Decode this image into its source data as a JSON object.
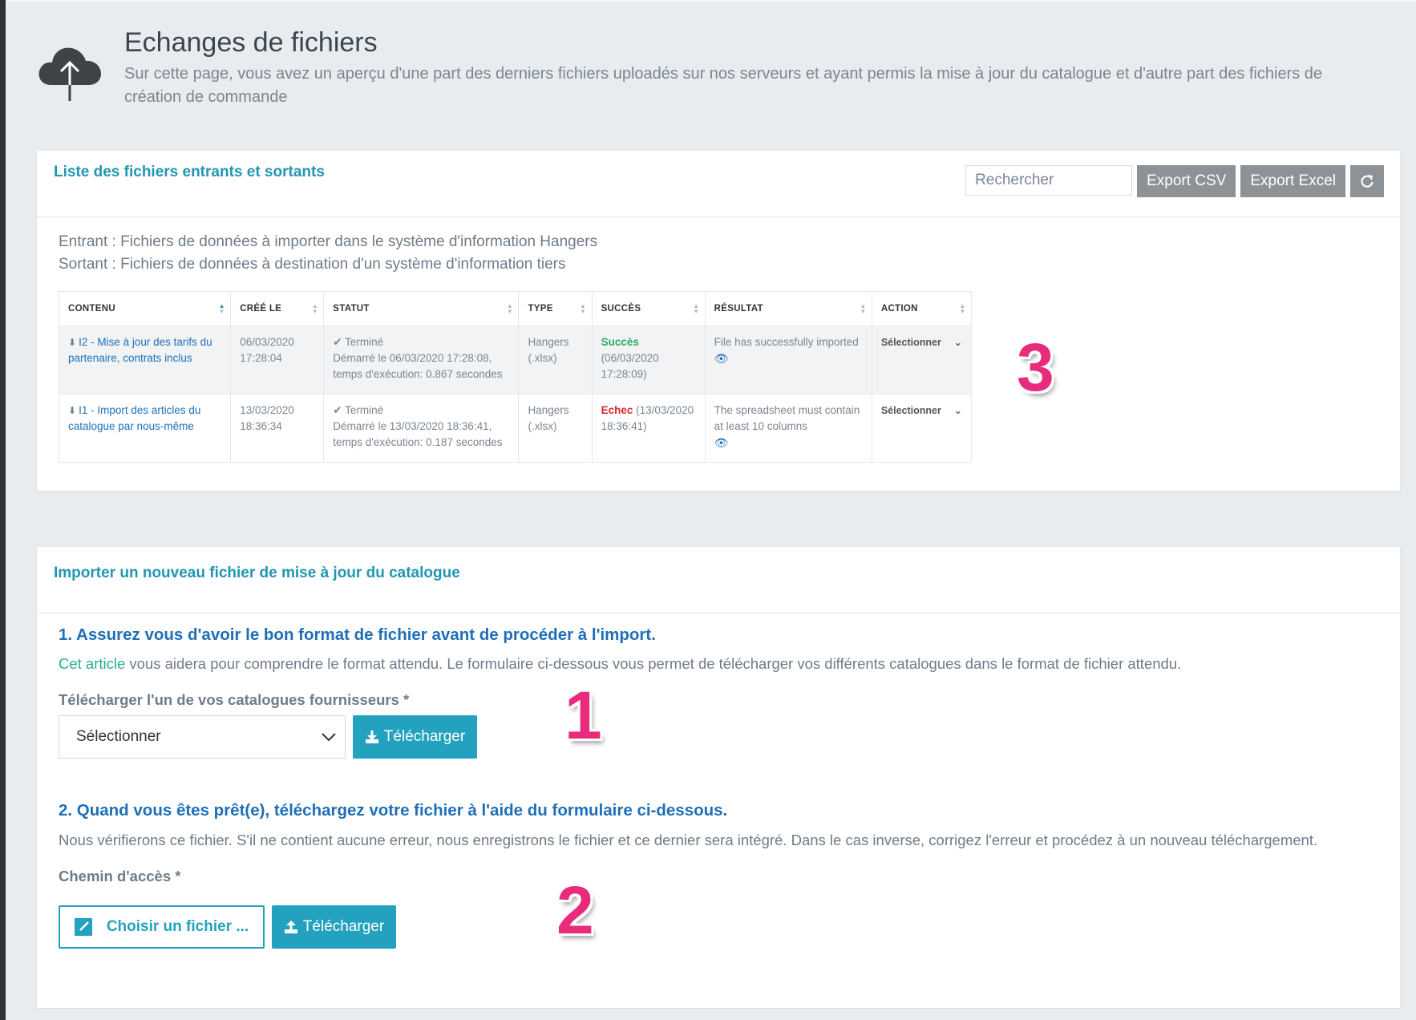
{
  "header": {
    "title": "Echanges de fichiers",
    "description": "Sur cette page, vous avez un aperçu d'une part des derniers fichiers uploadés sur nos serveurs et ayant permis la mise à jour du catalogue et d'autre part des fichiers de création de commande",
    "icon": "cloud-upload-icon"
  },
  "files_card": {
    "title": "Liste des fichiers entrants et sortants",
    "search_placeholder": "Rechercher",
    "export_csv": "Export CSV",
    "export_excel": "Export Excel",
    "refresh_icon": "refresh-icon",
    "legend_in": "Entrant : Fichiers de données à importer dans le système d'information Hangers",
    "legend_out": "Sortant : Fichiers de données à destination d'un système d'information tiers",
    "columns": [
      "CONTENU",
      "CRÉÉ LE",
      "STATUT",
      "TYPE",
      "SUCCÈS",
      "RÉSULTAT",
      "ACTION"
    ],
    "rows": [
      {
        "contenu": "I2 - Mise à jour des tarifs du partenaire, contrats inclus",
        "cree_le": "06/03/2020 17:28:04",
        "statut": "Terminé",
        "statut_detail": "Démarré le 06/03/2020 17:28:08, temps d'exécution: 0.867 secondes",
        "type": "Hangers (.xlsx)",
        "succes_label": "Succès",
        "succes_detail": "(06/03/2020 17:28:09)",
        "resultat": "File has successfully imported",
        "action": "Sélectionner"
      },
      {
        "contenu": "I1 - Import des articles du catalogue par nous-même",
        "cree_le": "13/03/2020 18:36:34",
        "statut": "Terminé",
        "statut_detail": "Démarré le 13/03/2020 18:36:41, temps d'exécution: 0.187 secondes",
        "type": "Hangers (.xlsx)",
        "succes_label": "Echec",
        "succes_detail": "(13/03/2020 18:36:41)",
        "resultat": "The spreadsheet must contain at least 10 columns",
        "action": "Sélectionner"
      }
    ],
    "annotation": "3"
  },
  "import_card": {
    "title": "Importer un nouveau fichier de mise à jour du catalogue",
    "step1_title": "1. Assurez vous d'avoir le bon format de fichier avant de procéder à l'import.",
    "step1_link": "Cet article",
    "step1_text": " vous aidera pour comprendre le format attendu. Le formulaire ci-dessous vous permet de télécharger vos différents catalogues dans le format de fichier attendu.",
    "catalog_label": "Télécharger l'un de vos catalogues fournisseurs *",
    "catalog_select": "Sélectionner",
    "download_button": "Télécharger",
    "annotation1": "1",
    "step2_title": "2. Quand vous êtes prêt(e), téléchargez votre fichier à l'aide du formulaire ci-dessous.",
    "step2_text": "Nous vérifierons ce fichier. S'il ne contient aucune erreur, nous enregistrons le fichier et ce dernier sera intégré. Dans le cas inverse, corrigez l'erreur et procédez à un nouveau téléchargement.",
    "path_label": "Chemin d'accès *",
    "choose_file": "Choisir un fichier ...",
    "upload_button": "Télécharger",
    "annotation2": "2"
  },
  "colors": {
    "accent": "#23a2bf",
    "link": "#1e6fb8",
    "success": "#27ae60",
    "error": "#d9262a",
    "annotation": "#e82b7a"
  }
}
